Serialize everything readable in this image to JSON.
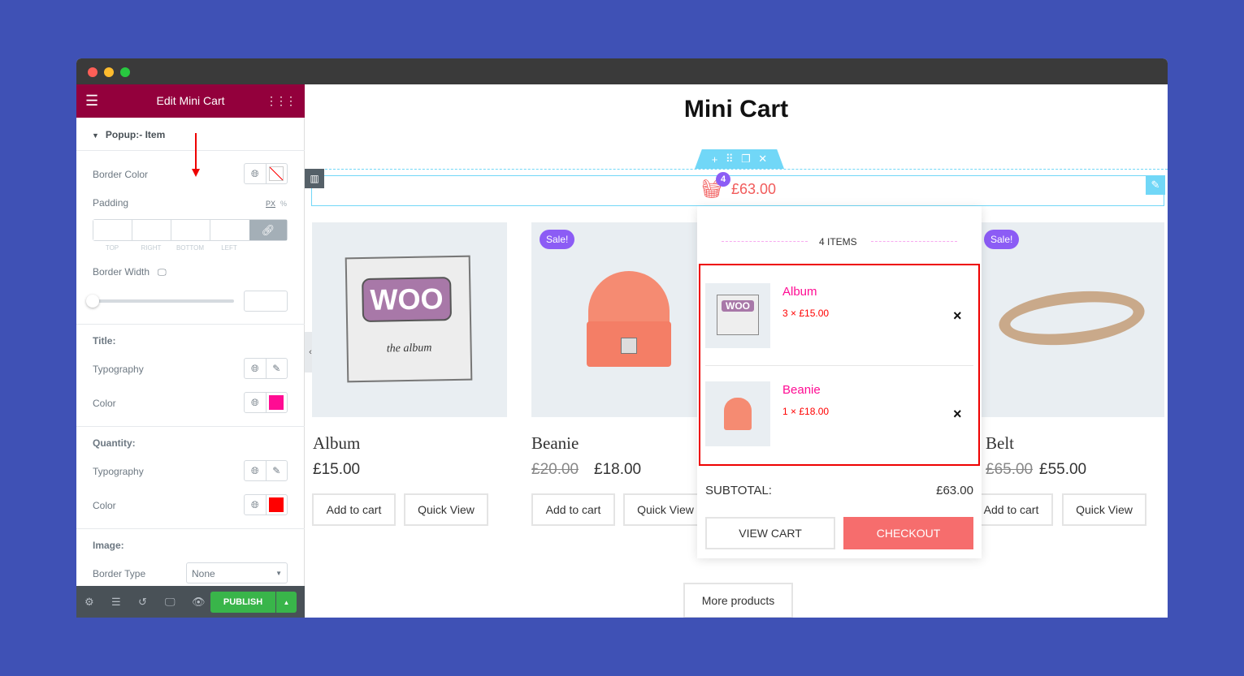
{
  "window": {
    "traffic_lights": [
      "#fe5f57",
      "#febc2e",
      "#28c840"
    ]
  },
  "sidebar": {
    "title": "Edit Mini Cart",
    "section": "Popup:- Item",
    "border_color_label": "Border Color",
    "padding_label": "Padding",
    "units": [
      "PX",
      "%"
    ],
    "padding_sides": [
      "TOP",
      "RIGHT",
      "BOTTOM",
      "LEFT"
    ],
    "border_width_label": "Border Width",
    "border_width_value": 0,
    "title_heading": "Title:",
    "typography_label": "Typography",
    "color_label": "Color",
    "title_color": "#ff0c93",
    "quantity_heading": "Quantity:",
    "quantity_color": "#ff0000",
    "image_heading": "Image:",
    "border_type_label": "Border Type",
    "border_type_value": "None",
    "publish": "PUBLISH",
    "accent": "#93003c"
  },
  "page": {
    "title": "Mini Cart",
    "cart_count": "4",
    "cart_total": "£63.00",
    "products": [
      {
        "name": "Album",
        "price": "£15.00",
        "old_price": "",
        "sale": ""
      },
      {
        "name": "Beanie",
        "price": "£18.00",
        "old_price": "£20.00",
        "sale": "Sale!"
      },
      {
        "name": "Belt",
        "price": "£55.00",
        "old_price": "£65.00",
        "sale": "Sale!"
      }
    ],
    "add_to_cart": "Add to cart",
    "quick_view": "Quick View",
    "more_products": "More products",
    "woo_text": "WOO",
    "album_sub": "the album"
  },
  "popup": {
    "items_label": "4 ITEMS",
    "items": [
      {
        "name": "Album",
        "qty": "3 × £15.00"
      },
      {
        "name": "Beanie",
        "qty": "1 × £18.00"
      }
    ],
    "subtotal_label": "SUBTOTAL:",
    "subtotal": "£63.00",
    "view_cart": "VIEW CART",
    "checkout": "CHECKOUT",
    "remove_icon": "×"
  }
}
